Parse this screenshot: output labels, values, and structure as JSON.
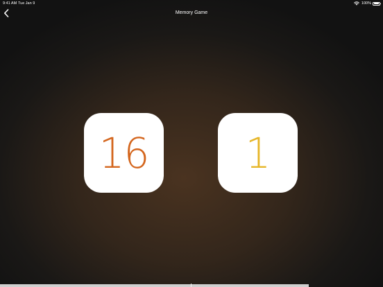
{
  "status_bar": {
    "time": "9:41 AM",
    "date": "Tue Jan 9",
    "battery_percent": "100%"
  },
  "nav": {
    "title": "Memory Game",
    "back_icon": "chevron-left-icon"
  },
  "cards": [
    {
      "value": "16",
      "color": "#d4661e"
    },
    {
      "value": "1",
      "color": "#e6b628"
    }
  ],
  "colors": {
    "card_background": "#ffffff",
    "background_center": "#4a3320",
    "background_edge": "#121212"
  }
}
